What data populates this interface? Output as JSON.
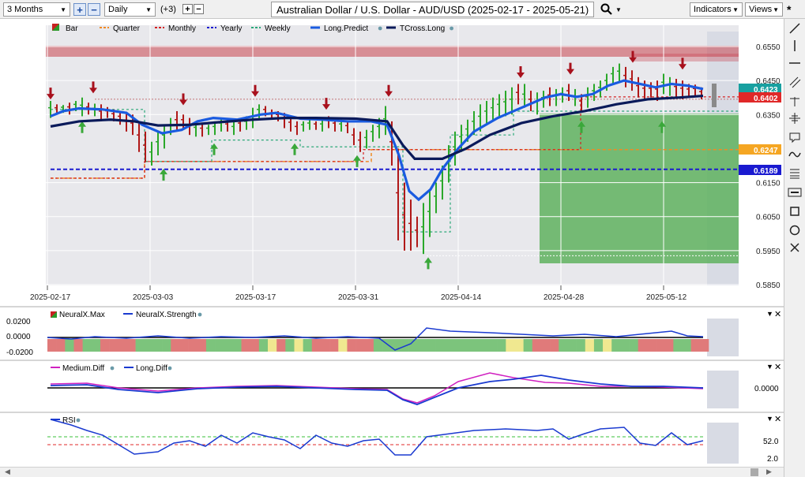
{
  "toolbar": {
    "timeframe": "3 Months",
    "interval": "Daily",
    "offset": "(+3)",
    "title": "Australian Dollar / U.S. Dollar - AUD/USD (2025-02-17 - 2025-05-21)",
    "indicators_label": "Indicators",
    "views_label": "Views",
    "search_icon": "search-icon",
    "pin_icon": "asterisk-pin-icon"
  },
  "legend_main": [
    {
      "label": "Bar",
      "color": "#2a9a2a",
      "style": "bar-icon"
    },
    {
      "label": "Quarter",
      "color": "#f08a24",
      "style": "dashed"
    },
    {
      "label": "Monthly",
      "color": "#d42020",
      "style": "dashed"
    },
    {
      "label": "Yearly",
      "color": "#1a1ad0",
      "style": "dashed"
    },
    {
      "label": "Weekly",
      "color": "#2aa878",
      "style": "dashed"
    },
    {
      "label": "Long.Predict",
      "color": "#1a5be0",
      "style": "solid"
    },
    {
      "label": "TCross.Long",
      "color": "#0a1a5a",
      "style": "solid"
    }
  ],
  "price_axis": {
    "ticks": [
      "0.6550",
      "0.6450",
      "0.6350",
      "0.6150",
      "0.6050",
      "0.5950",
      "0.5850"
    ],
    "labels": [
      {
        "text": "0.6423",
        "color": "#18a0a0"
      },
      {
        "text": "0.6402",
        "color": "#e02828"
      },
      {
        "text": "0.6247",
        "color": "#f5a623"
      },
      {
        "text": "0.6189",
        "color": "#1a1ad0"
      }
    ]
  },
  "date_axis": [
    "2025-02-17",
    "2025-03-03",
    "2025-03-17",
    "2025-03-31",
    "2025-04-14",
    "2025-04-28",
    "2025-05-12"
  ],
  "panel_neuralx": {
    "legend": [
      "NeuralX.Max",
      "NeuralX.Strength"
    ],
    "ticks": [
      "0.0200",
      "0.0000",
      "-0.0200"
    ],
    "strength_colors": [
      "red",
      "red",
      "green",
      "red",
      "green",
      "green",
      "red",
      "red",
      "red",
      "red",
      "green",
      "green",
      "green",
      "green",
      "red",
      "red",
      "red",
      "red",
      "green",
      "green",
      "green",
      "green",
      "red",
      "red",
      "green",
      "yellow",
      "red",
      "green",
      "yellow",
      "green",
      "red",
      "red",
      "red",
      "yellow",
      "red",
      "red",
      "red",
      "green",
      "green",
      "green",
      "green",
      "green",
      "green",
      "green",
      "green",
      "green",
      "green",
      "green",
      "green",
      "green",
      "green",
      "green",
      "yellow",
      "yellow",
      "green",
      "red",
      "red",
      "red",
      "green",
      "green",
      "green",
      "yellow",
      "green",
      "yellow",
      "green",
      "green",
      "green",
      "red",
      "red",
      "red",
      "red",
      "green",
      "green",
      "red",
      "red"
    ]
  },
  "panel_diff": {
    "legend": [
      "Medium.Diff",
      "Long.Diff"
    ],
    "ticks": [
      "0.0000"
    ]
  },
  "panel_rsi": {
    "legend": [
      "RSI"
    ],
    "ticks": [
      "52.0",
      "2.0"
    ]
  }
}
